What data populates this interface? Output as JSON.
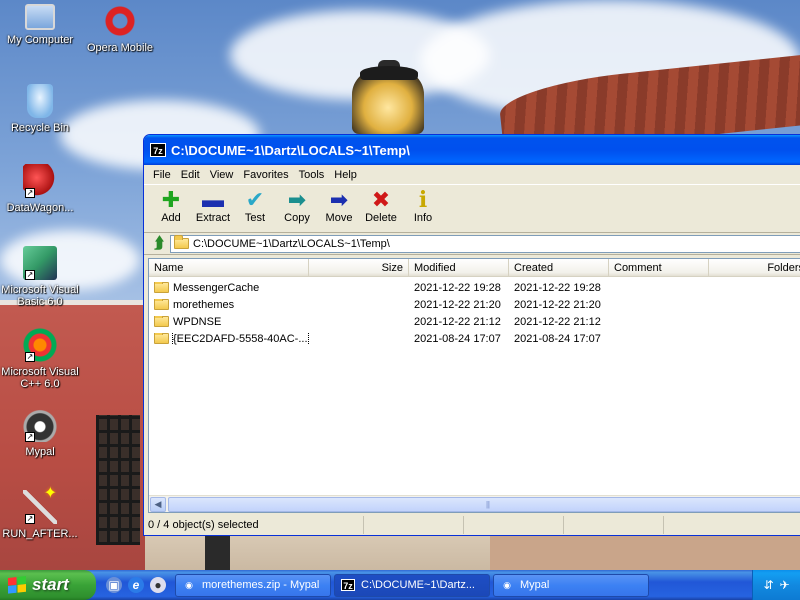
{
  "desktop": {
    "icons": [
      {
        "label": "My Computer",
        "icon": "my-computer-icon"
      },
      {
        "label": "Opera Mobile",
        "icon": "opera-icon"
      },
      {
        "label": "Recycle Bin",
        "icon": "recycle-bin-icon"
      },
      {
        "label": "DataWagon...",
        "icon": "datawagon-icon"
      },
      {
        "label": "Microsoft Visual Basic 6.0",
        "icon": "visual-basic-icon"
      },
      {
        "label": "Microsoft Visual C++ 6.0",
        "icon": "visual-cpp-icon"
      },
      {
        "label": "Mypal",
        "icon": "mypal-icon"
      },
      {
        "label": "RUN_AFTER...",
        "icon": "magic-wand-icon"
      }
    ]
  },
  "window": {
    "title": "C:\\DOCUME~1\\Dartz\\LOCALS~1\\Temp\\",
    "app_badge": "7z",
    "menu": [
      "File",
      "Edit",
      "View",
      "Favorites",
      "Tools",
      "Help"
    ],
    "toolbar": {
      "add": "Add",
      "extract": "Extract",
      "test": "Test",
      "copy": "Copy",
      "move": "Move",
      "delete": "Delete",
      "info": "Info"
    },
    "address": "C:\\DOCUME~1\\Dartz\\LOCALS~1\\Temp\\",
    "columns": [
      "Name",
      "Size",
      "Modified",
      "Created",
      "Comment",
      "Folders"
    ],
    "rows": [
      {
        "name": "MessengerCache",
        "size": "",
        "modified": "2021-12-22 19:28",
        "created": "2021-12-22 19:28"
      },
      {
        "name": "morethemes",
        "size": "",
        "modified": "2021-12-22 21:20",
        "created": "2021-12-22 21:20"
      },
      {
        "name": "WPDNSE",
        "size": "",
        "modified": "2021-12-22 21:12",
        "created": "2021-12-22 21:12"
      },
      {
        "name": "{EEC2DAFD-5558-40AC-...",
        "size": "",
        "modified": "2021-08-24 17:07",
        "created": "2021-08-24 17:07"
      }
    ],
    "status": "0 / 4 object(s) selected"
  },
  "taskbar": {
    "start": "start",
    "tasks": [
      {
        "label": "morethemes.zip - Mypal",
        "icon": "mypal-icon"
      },
      {
        "label": "C:\\DOCUME~1\\Dartz...",
        "icon": "7zip-icon",
        "badge": "7z"
      },
      {
        "label": "Mypal",
        "icon": "mypal-icon"
      }
    ]
  }
}
